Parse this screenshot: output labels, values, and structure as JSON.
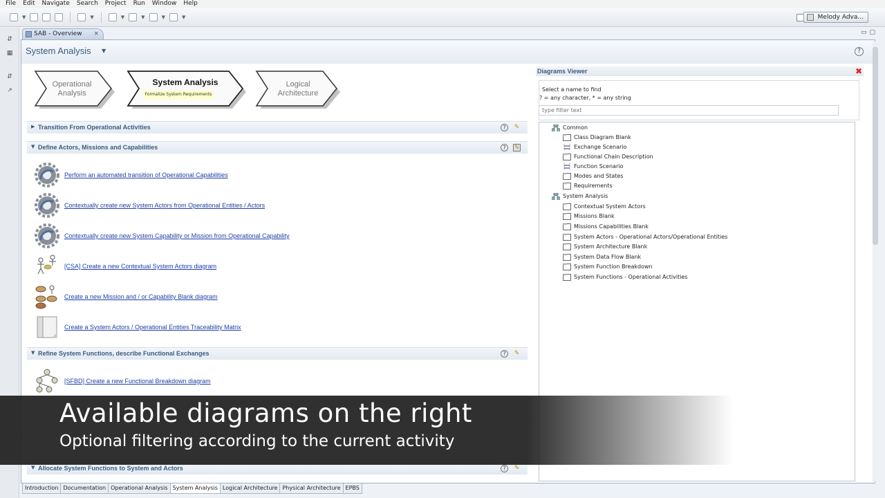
{
  "menu": [
    "File",
    "Edit",
    "Navigate",
    "Search",
    "Project",
    "Run",
    "Window",
    "Help"
  ],
  "toolbar": {
    "perspective_label": "Melody Adva..."
  },
  "editor_tab": {
    "label": "SAB - Overview",
    "close": "×"
  },
  "header": {
    "title": "System Analysis",
    "help": "?"
  },
  "process": {
    "operational_analysis": [
      "Operational",
      "Analysis"
    ],
    "system_analysis": "System Analysis",
    "system_analysis_sub": "Formalize System Requirements",
    "logical_architecture": [
      "Logical",
      "Architecture"
    ]
  },
  "sections": [
    {
      "title": "Transition From Operational Activities",
      "expanded": false
    },
    {
      "title": "Define Actors, Missions and Capabilities",
      "expanded": true
    },
    {
      "title": "Refine System Functions, describe Functional Exchanges",
      "expanded": true
    },
    {
      "title": "Allocate System Functions to System and Actors",
      "expanded": true
    }
  ],
  "entries": [
    "Perform an automated transition of Operational Capabilities",
    "Contextually create new System Actors from Operational Entities / Actors",
    "Contextually create new System Capability or Mission from Operational Capability",
    "[CSA] Create a new Contextual System Actors diagram",
    "Create a new Mission and / or Capability  Blank diagram",
    "Create a System Actors / Operational Entities Traceability Matrix",
    "[SFBD] Create a new Functional Breakdown diagram"
  ],
  "diagrams_viewer": {
    "title": "Diagrams Viewer",
    "close": "✖",
    "prompt": "Select a name to find",
    "hint": "? = any character, * = any string",
    "filter_placeholder": "type filter text",
    "tree": {
      "common": "Common",
      "common_items": [
        "Class Diagram Blank",
        "Exchange Scenario",
        "Functional Chain Description",
        "Function Scenario",
        "Modes and States",
        "Requirements"
      ],
      "system_analysis": "System Analysis",
      "system_items": [
        "Contextual System Actors",
        "Missions Blank",
        "Missions Capabilities Blank",
        "System Actors - Operational Actors/Operational Entities",
        "System Architecture Blank",
        "System Data Flow Blank",
        "System Function Breakdown",
        "System Functions - Operational Activities"
      ]
    }
  },
  "bottom_tabs": [
    "Introduction",
    "Documentation",
    "Operational Analysis",
    "System Analysis",
    "Logical Architecture",
    "Physical Architecture",
    "EPBS"
  ],
  "caption": {
    "title": "Available diagrams on the right",
    "subtitle": "Optional filtering according to the current activity"
  },
  "colors": {
    "accent": "#3b5a80",
    "link": "#1f3fa8",
    "active_highlight": "#ffffc8"
  }
}
